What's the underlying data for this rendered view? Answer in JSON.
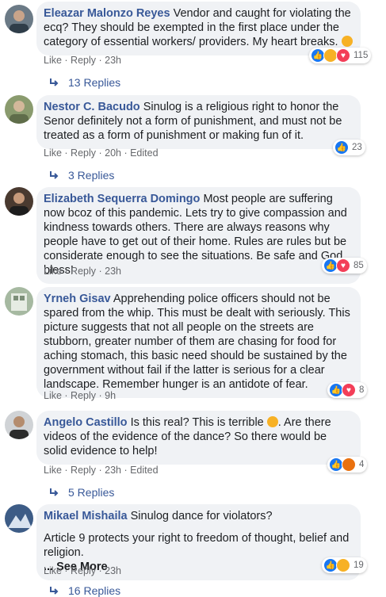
{
  "actions": {
    "like": "Like",
    "reply": "Reply",
    "edited": "Edited",
    "sep": " · "
  },
  "comments": [
    {
      "author": "Eleazar Malonzo Reyes",
      "text": "Vendor and caught for violating the ecq? They should be exempted in the first place under the category of essential workers/ providers. My heart breaks.",
      "time": "23h",
      "reactions": [
        "like",
        "sad",
        "heart"
      ],
      "count": "115",
      "replies": "13 Replies"
    },
    {
      "author": "Nestor C. Bacudo",
      "text": "Sinulog is a religious right to honor the Senor definitely not a form of punishment, and must not be treated as a form of punishment or making fun of it.",
      "time": "20h",
      "edited": true,
      "reactions": [
        "like"
      ],
      "count": "23",
      "replies": "3 Replies"
    },
    {
      "author": "Elizabeth Sequerra Domingo",
      "text": "Most people are suffering now bcoz of this pandemic. Lets try to give compassion and kindness towards others. There are always reasons why people have to get out of their home. Rules are rules but be considerate enough to see the situations. Be safe and God bless!",
      "time": "23h",
      "reactions": [
        "like",
        "heart"
      ],
      "count": "85"
    },
    {
      "author": "Yrneh Gisav",
      "text": "Apprehending police officers should not be spared from the whip. This must be dealt with seriously. This picture suggests that not all people on the streets are stubborn, greater number of them are chasing for food for aching stomach, this basic need should be sustained by the government without fail if the latter is serious for a clear landscape. Remember hunger is an antidote of fear.",
      "time": "9h",
      "reactions": [
        "like",
        "heart"
      ],
      "count": "8"
    },
    {
      "author": "Angelo Castillo",
      "text": "Is this real? This is terrible",
      "text_after": ". Are there videos of the evidence of the dance? So there would be solid evidence to help!",
      "time": "23h",
      "edited": true,
      "reactions": [
        "like",
        "angry"
      ],
      "count": "4",
      "replies": "5 Replies"
    },
    {
      "author": "Mikael Mishaila",
      "text": "Sinulog dance for violators?",
      "text_line2": "Article 9 protects your right to freedom of thought, belief and religion.",
      "see_more": "... See More",
      "time": "23h",
      "reactions": [
        "like",
        "haha"
      ],
      "count": "19",
      "replies": "16 Replies"
    }
  ],
  "colors": {
    "author": "#385898",
    "bubble": "#f0f2f5",
    "like": "#1877f2",
    "heart": "#f33e58"
  }
}
